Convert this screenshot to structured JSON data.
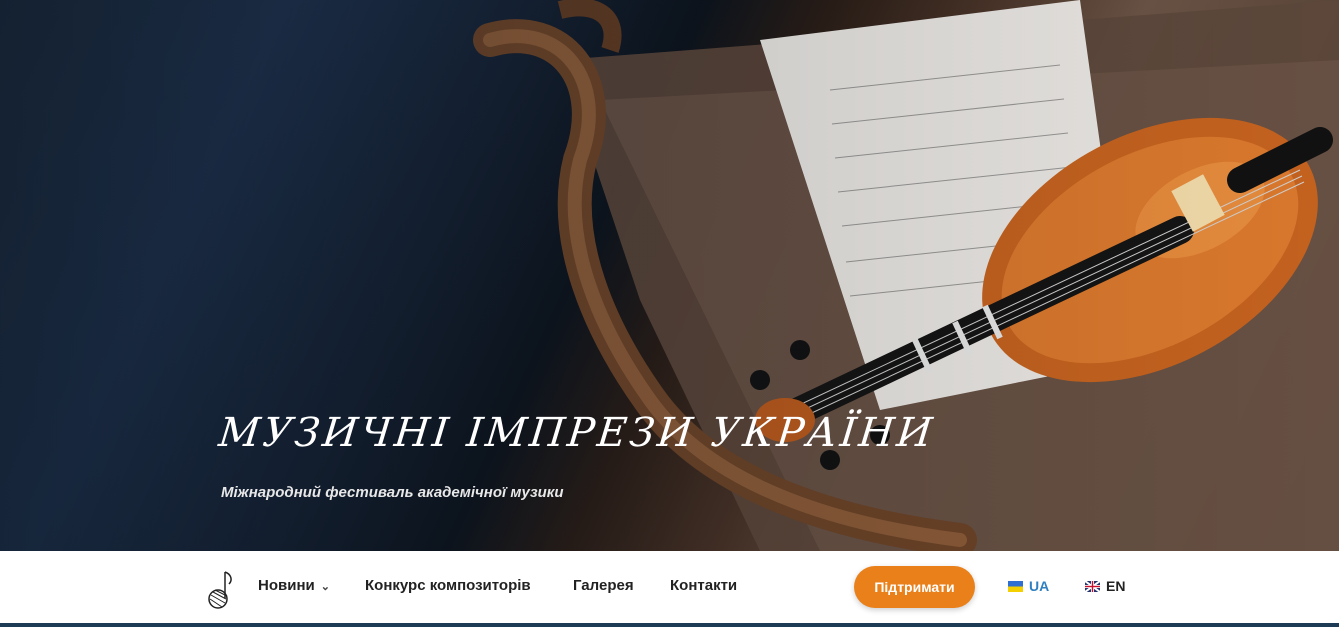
{
  "hero": {
    "title": "МУЗИЧНІ ІМПРЕЗИ УКРАЇНИ",
    "subtitle": "Міжнародний фестиваль академічної музики"
  },
  "nav": {
    "items": [
      {
        "label": "Новини"
      },
      {
        "label": "Конкурс композиторів"
      },
      {
        "label": "Галерея"
      },
      {
        "label": "Контакти"
      }
    ],
    "cta_label": "Підтримати",
    "languages": [
      {
        "code": "UA",
        "color": "#2f7fc1"
      },
      {
        "code": "EN",
        "color": "#222222"
      }
    ]
  },
  "colors": {
    "accent": "#e9801a",
    "dark_blue": "#1e3b56"
  },
  "icons": {
    "logo": "music-note-logo-icon",
    "chevron": "chevron-down-icon",
    "ua_flag": "ukraine-flag-icon",
    "en_flag": "uk-flag-icon"
  }
}
